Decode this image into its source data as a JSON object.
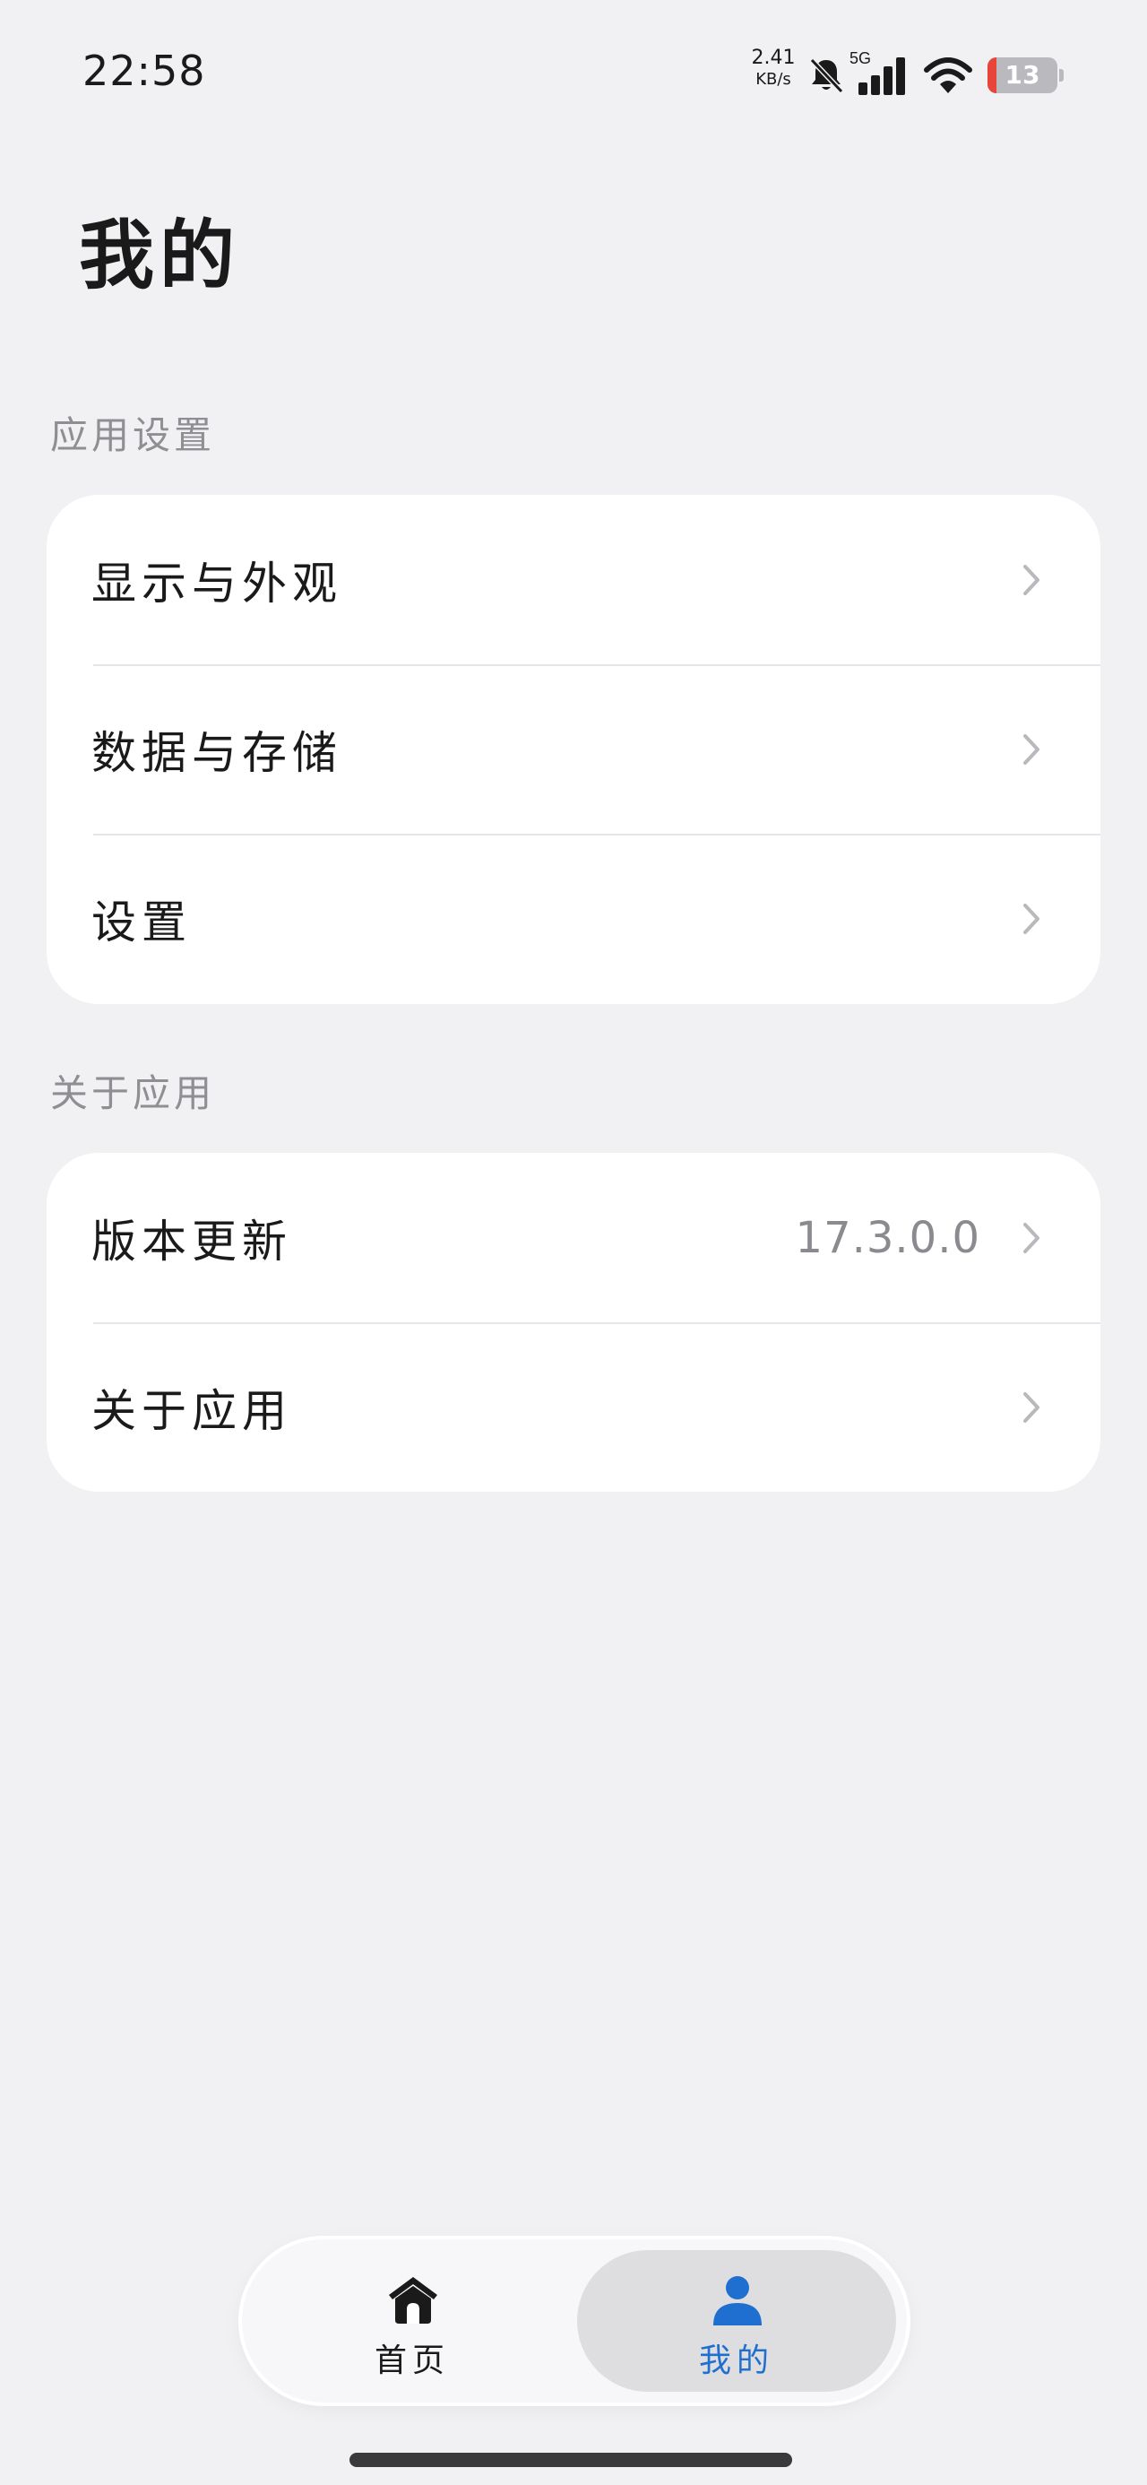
{
  "status_bar": {
    "time": "22:58",
    "net_speed_value": "2.41",
    "net_speed_unit": "KB/s",
    "network_type": "5G",
    "battery_percent": "13",
    "icons": [
      "bell-muted-icon",
      "signal-icon",
      "wifi-icon",
      "battery-icon"
    ]
  },
  "page": {
    "title": "我的"
  },
  "sections": [
    {
      "label": "应用设置",
      "items": [
        {
          "label": "显示与外观"
        },
        {
          "label": "数据与存储"
        },
        {
          "label": "设置"
        }
      ]
    },
    {
      "label": "关于应用",
      "items": [
        {
          "label": "版本更新",
          "value": "17.3.0.0"
        },
        {
          "label": "关于应用"
        }
      ]
    }
  ],
  "bottom_nav": {
    "items": [
      {
        "label": "首页",
        "icon": "home-icon",
        "active": false
      },
      {
        "label": "我的",
        "icon": "person-icon",
        "active": true
      }
    ]
  },
  "colors": {
    "background": "#f1f1f4",
    "card": "#ffffff",
    "accent": "#1f6fd1",
    "battery_low": "#e8443a",
    "secondary_text": "#8e8e93"
  }
}
